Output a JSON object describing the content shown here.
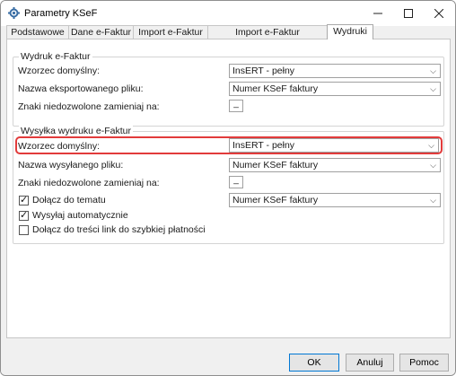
{
  "window": {
    "title": "Parametry KSeF"
  },
  "tabs": [
    {
      "label": "Podstawowe"
    },
    {
      "label": "Dane e-Faktur"
    },
    {
      "label": "Import e-Faktur"
    },
    {
      "label": "Import e-Faktur zaliczkowych"
    },
    {
      "label": "Wydruki"
    }
  ],
  "active_tab": "Wydruki",
  "group1": {
    "title": "Wydruk e-Faktur",
    "default_template_label": "Wzorzec domyślny:",
    "default_template_value": "InsERT - pełny",
    "export_file_label": "Nazwa eksportowanego pliku:",
    "export_file_value": "Numer KSeF faktury",
    "invalid_chars_label": "Znaki niedozwolone zamieniaj na:",
    "invalid_chars_value": "_"
  },
  "group2": {
    "title": "Wysyłka wydruku e-Faktur",
    "default_template_label": "Wzorzec domyślny:",
    "default_template_value": "InsERT - pełny",
    "sent_file_label": "Nazwa wysyłanego pliku:",
    "sent_file_value": "Numer KSeF faktury",
    "invalid_chars_label": "Znaki niedozwolone zamieniaj na:",
    "invalid_chars_value": "_",
    "attach_subject_label": "Dołącz do tematu",
    "attach_subject_checked": true,
    "attach_subject_value": "Numer KSeF faktury",
    "send_auto_label": "Wysyłaj automatycznie",
    "send_auto_checked": true,
    "attach_link_label": "Dołącz do treści link do szybkiej płatności",
    "attach_link_checked": false
  },
  "buttons": {
    "ok": "OK",
    "cancel": "Anuluj",
    "help": "Pomoc"
  },
  "colors": {
    "highlight": "#e23b3b"
  }
}
